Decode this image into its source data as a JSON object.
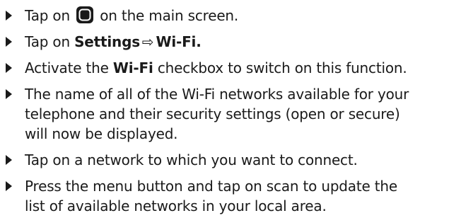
{
  "steps": [
    {
      "pre": "Tap on ",
      "icon": "home-button-icon",
      "post": " on the main screen."
    },
    {
      "pre": "Tap on ",
      "bold1": "Settings",
      "arrow": "⇨",
      "bold2": "Wi-Fi."
    },
    {
      "pre": "Activate the ",
      "bold": "Wi-Fi",
      "post": " checkbox to switch on this function."
    },
    {
      "line1": "The name of all of the Wi-Fi networks available for your",
      "line2": "telephone and their security settings (open or secure)",
      "line3": "will now be displayed."
    },
    {
      "text": "Tap on a network to which you want to connect."
    },
    {
      "line1": "Press the menu button and tap on scan to update the",
      "line2": "list of available networks in your local area."
    }
  ]
}
